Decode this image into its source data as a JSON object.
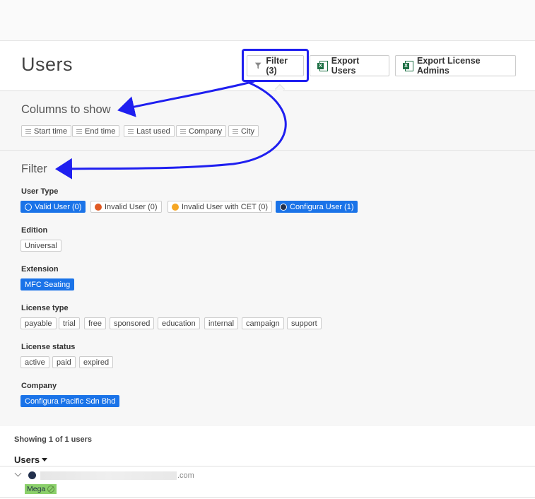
{
  "page": {
    "title": "Users"
  },
  "toolbar": {
    "filter_label": "Filter (3)",
    "export_users_label": "Export Users",
    "export_admins_label": "Export License Admins"
  },
  "columns_section": {
    "title": "Columns to show",
    "columns": [
      "Start time",
      "End time",
      "Last used",
      "Company",
      "City"
    ]
  },
  "filter_section": {
    "title": "Filter",
    "user_type": {
      "label": "User Type",
      "options": [
        {
          "label": "Valid User (0)",
          "color": "#ffffff",
          "selected": true
        },
        {
          "label": "Invalid User (0)",
          "color": "#e05a24",
          "selected": false
        },
        {
          "label": "Invalid User with CET (0)",
          "color": "#f5a623",
          "selected": false
        },
        {
          "label": "Configura User (1)",
          "color": "#22304d",
          "selected": true
        }
      ]
    },
    "edition": {
      "label": "Edition",
      "options": [
        "Universal"
      ]
    },
    "extension": {
      "label": "Extension",
      "options": [
        "MFC Seating"
      ]
    },
    "license_type": {
      "label": "License type",
      "options": [
        "payable",
        "trial",
        "free",
        "sponsored",
        "education",
        "internal",
        "campaign",
        "support"
      ]
    },
    "license_status": {
      "label": "License status",
      "options": [
        "active",
        "paid",
        "expired"
      ]
    },
    "company": {
      "label": "Company",
      "options": [
        "Configura Pacific Sdn Bhd"
      ]
    }
  },
  "results": {
    "summary": "Showing 1 of 1 users",
    "column_header": "Users",
    "rows": [
      {
        "email_suffix": ".com",
        "tag": "Mega"
      }
    ]
  },
  "colors": {
    "accent": "#1a73e8",
    "annotation": "#1f1ff0",
    "tag_green": "#8bd06b",
    "configura_dot": "#22304d"
  }
}
